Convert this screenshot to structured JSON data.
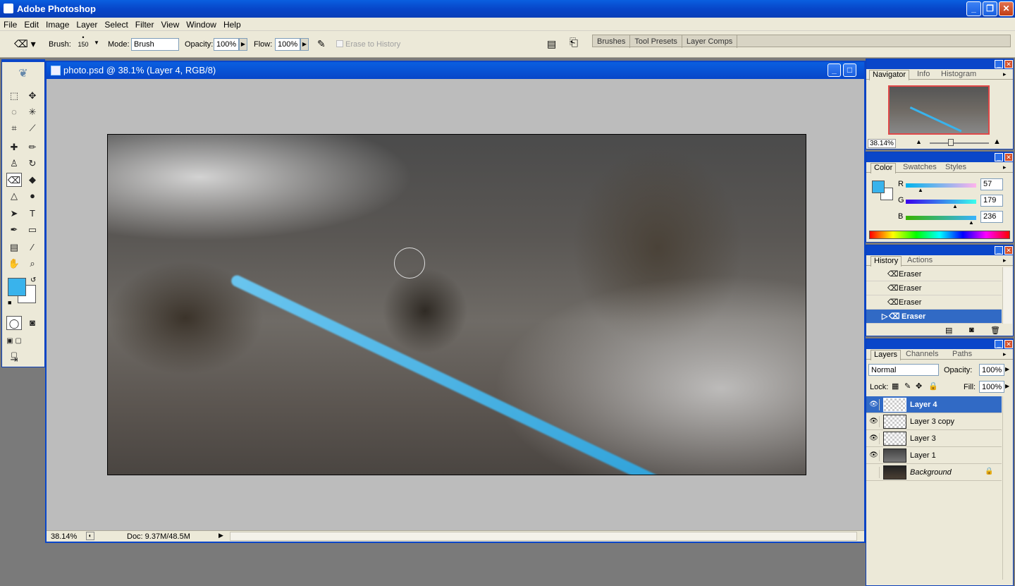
{
  "app": {
    "title": "Adobe Photoshop"
  },
  "menu": [
    "File",
    "Edit",
    "Image",
    "Layer",
    "Select",
    "Filter",
    "View",
    "Window",
    "Help"
  ],
  "options": {
    "brush_label": "Brush:",
    "brush_size": "150",
    "mode_label": "Mode:",
    "mode_value": "Brush",
    "opacity_label": "Opacity:",
    "opacity_value": "100%",
    "flow_label": "Flow:",
    "flow_value": "100%",
    "erase_history": "Erase to History"
  },
  "palette_well": [
    "Brushes",
    "Tool Presets",
    "Layer Comps"
  ],
  "document": {
    "title": "photo.psd @ 38.1% (Layer 4, RGB/8)",
    "zoom": "38.14%",
    "doc_info": "Doc: 9.37M/48.5M"
  },
  "navigator": {
    "tabs": [
      "Navigator",
      "Info",
      "Histogram"
    ],
    "zoom": "38.14%"
  },
  "color": {
    "tabs": [
      "Color",
      "Swatches",
      "Styles"
    ],
    "r_label": "R",
    "g_label": "G",
    "b_label": "B",
    "r": "57",
    "g": "179",
    "b": "236",
    "foreground": "#39b3ec",
    "background": "#ffffff"
  },
  "history": {
    "tabs": [
      "History",
      "Actions"
    ],
    "items": [
      "Eraser",
      "Eraser",
      "Eraser",
      "Eraser"
    ]
  },
  "layers": {
    "tabs": [
      "Layers",
      "Channels",
      "Paths"
    ],
    "blend_mode": "Normal",
    "opacity_label": "Opacity:",
    "opacity": "100%",
    "lock_label": "Lock:",
    "fill_label": "Fill:",
    "fill": "100%",
    "items": [
      "Layer 4",
      "Layer 3 copy",
      "Layer 3",
      "Layer 1",
      "Background"
    ]
  }
}
